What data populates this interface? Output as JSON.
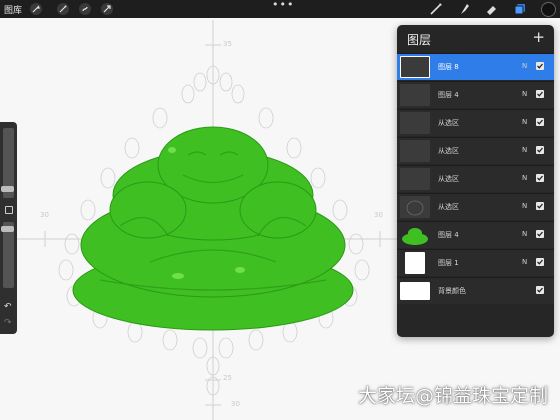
{
  "topbar": {
    "gallery_label": "图库",
    "menu_dots": "•••",
    "tools": [
      "brush-icon",
      "smudge-icon",
      "eraser-icon",
      "layers-icon"
    ],
    "active_color": "#111111"
  },
  "canvas": {
    "guide_labels": {
      "top": "35",
      "left": "30",
      "right": "30",
      "bottom_inner": "25",
      "bottom": "30"
    },
    "object_color": "#3fbf22"
  },
  "sidebar": {
    "undo": "↶",
    "redo": "↷"
  },
  "layers_panel": {
    "title": "图层",
    "add_label": "+",
    "layers": [
      {
        "name": "图层 8",
        "mode": "N",
        "selected": true
      },
      {
        "name": "图层 4",
        "mode": "N",
        "selected": false
      },
      {
        "name": "从选区",
        "mode": "N",
        "selected": false
      },
      {
        "name": "从选区",
        "mode": "N",
        "selected": false
      },
      {
        "name": "从选区",
        "mode": "N",
        "selected": false
      },
      {
        "name": "从选区",
        "mode": "N",
        "selected": false
      },
      {
        "name": "图层 4",
        "mode": "N",
        "selected": false
      },
      {
        "name": "图层 1",
        "mode": "N",
        "selected": false
      },
      {
        "name": "背景颜色",
        "mode": "",
        "selected": false
      }
    ]
  },
  "watermark": "大家坛@锦益珠宝定制"
}
